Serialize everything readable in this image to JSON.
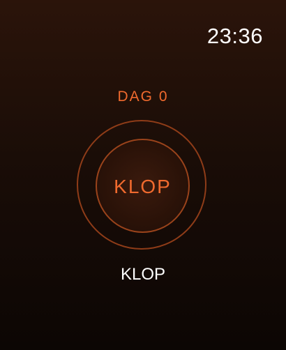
{
  "status_bar": {
    "time": "23:36"
  },
  "counter": {
    "day_label": "DAG 0",
    "button_label": "KLOP",
    "caption": "KLOP"
  },
  "colors": {
    "accent": "#f06a2e",
    "ring": "#8f3c18",
    "background_top": "#2b140a",
    "background_bottom": "#0c0604",
    "text": "#ffffff"
  }
}
